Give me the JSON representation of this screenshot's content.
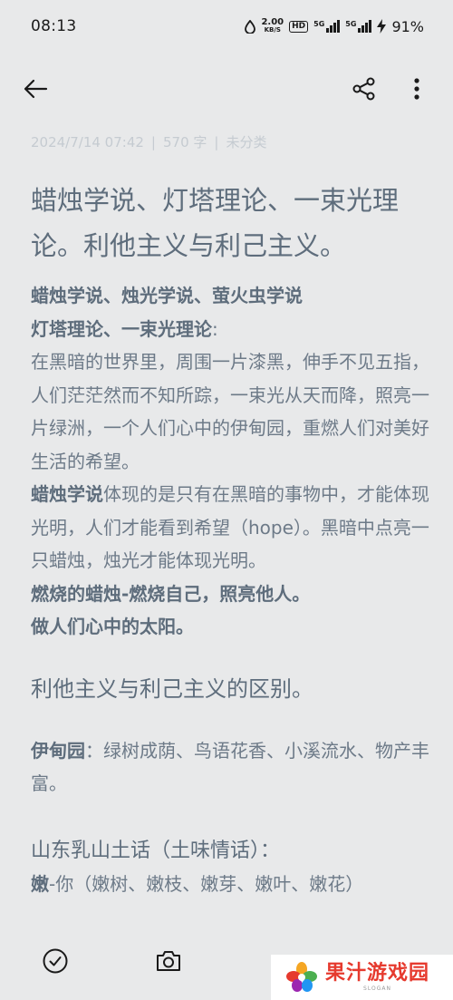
{
  "status_bar": {
    "time": "08:13",
    "net_speed_value": "2.00",
    "net_speed_unit": "KB/S",
    "hd_label": "HD",
    "sim1_tag": "5G",
    "sim2_tag": "5G",
    "battery": "91%"
  },
  "meta": {
    "date": "2024/7/14 07:42",
    "char_count": "570 字",
    "category": "未分类",
    "separator": "|"
  },
  "note": {
    "title": "蜡烛学说、灯塔理论、一束光理论。利他主义与利己主义。",
    "line1": "蜡烛学说、烛光学说、萤火虫学说",
    "line2_bold": "灯塔理论、一束光理论",
    "line2_tail": ":",
    "para1": "在黑暗的世界里，周围一片漆黑，伸手不见五指，人们茫茫然而不知所踪，一束光从天而降，照亮一片绿洲，一个人们心中的伊甸园，重燃人们对美好生活的希望。",
    "para2_bold": "蜡烛学说",
    "para2_rest": "体现的是只有在黑暗的事物中，才能体现光明，人们才能看到希望（hope）。黑暗中点亮一只蜡烛，烛光才能体现光明。",
    "line3": "燃烧的蜡烛-燃烧自己，照亮他人。",
    "line4": "做人们心中的太阳。",
    "heading2": "利他主义与利己主义的区别。",
    "eden_label": "伊甸园",
    "eden_text": "：绿树成荫、鸟语花香、小溪流水、物产丰富。",
    "heading3": "山东乳山土话（土味情话）：",
    "last_bold": "嫩",
    "last_rest": "-你（嫩树、嫩枝、嫩芽、嫩叶、嫩花）"
  },
  "watermark": {
    "title": "果汁游戏园",
    "sub": "SLOGAN"
  },
  "icons": {
    "back": "arrow-left-icon",
    "share": "share-icon",
    "more": "more-vertical-icon",
    "check": "check-circle-icon",
    "camera": "camera-icon"
  },
  "colors": {
    "background": "#e8e9ea",
    "text": "#6d7a88",
    "meta": "#c5cbd1",
    "watermark_red": "#e63a2e"
  }
}
